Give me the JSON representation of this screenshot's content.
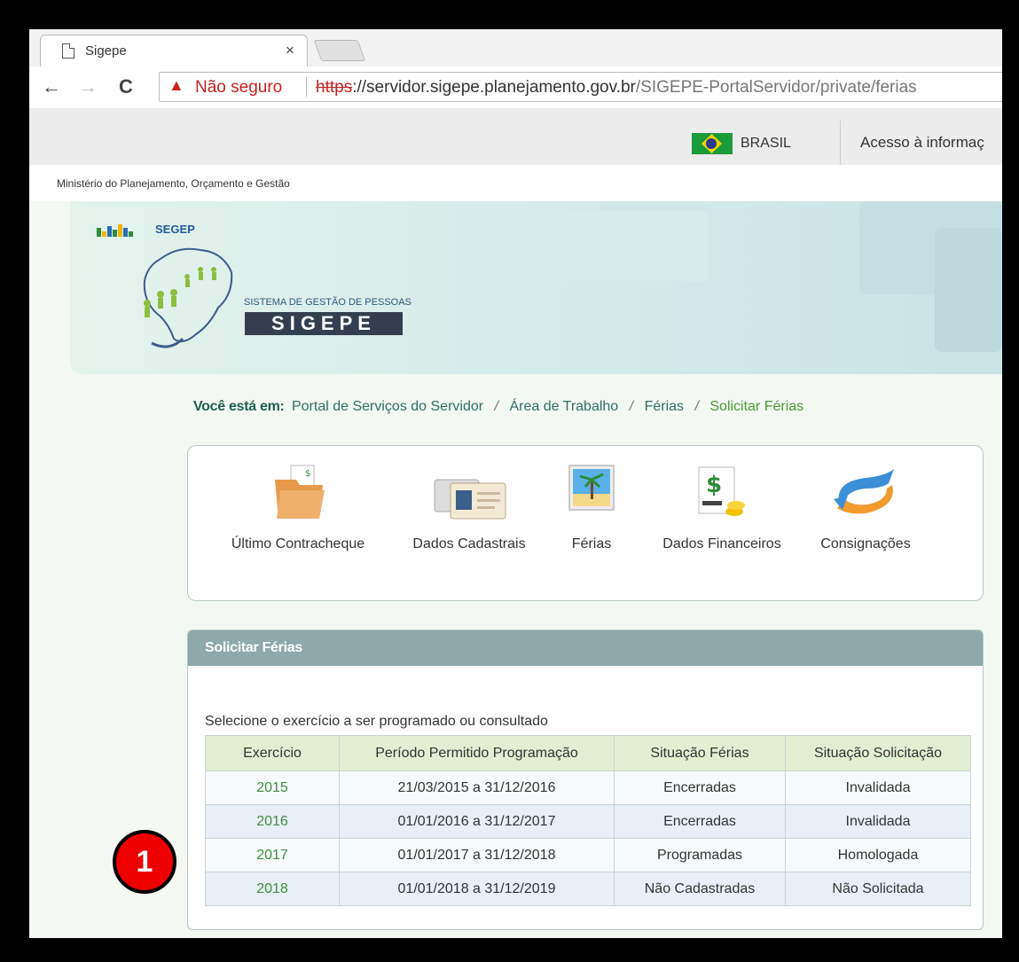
{
  "browser": {
    "tab_title": "Sigepe",
    "tab_close": "×",
    "security_label": "Não seguro",
    "url_scheme": "https",
    "url_sep": "://",
    "url_host": "servidor.sigepe.planejamento.gov.br",
    "url_path": "/SIGEPE-PortalServidor/private/ferias"
  },
  "govbar": {
    "country": "BRASIL",
    "access_info": "Acesso à informaç"
  },
  "ministry": "Ministério do Planejamento, Orçamento e Gestão",
  "brand": {
    "segep": "SEGEP",
    "system_name": "SISTEMA DE GESTÃO DE PESSOAS",
    "logo_text": "SIGEPE"
  },
  "breadcrumb": {
    "label": "Você está em:",
    "items": [
      "Portal de Serviços do Servidor",
      "Área de Trabalho",
      "Férias"
    ],
    "current": "Solicitar Férias",
    "separator": "/"
  },
  "services": [
    {
      "label": "Último Contracheque",
      "icon": "paycheck-folder-icon"
    },
    {
      "label": "Dados Cadastrais",
      "icon": "id-card-icon"
    },
    {
      "label": "Férias",
      "icon": "beach-photo-icon"
    },
    {
      "label": "Dados Financeiros",
      "icon": "money-document-icon"
    },
    {
      "label": "Consignações",
      "icon": "swirl-arrow-icon"
    }
  ],
  "panel": {
    "title": "Solicitar Férias",
    "instruction": "Selecione o exercício a ser programado ou consultado",
    "columns": [
      "Exercício",
      "Período Permitido Programação",
      "Situação Férias",
      "Situação Solicitação"
    ],
    "rows": [
      {
        "exercicio": "2015",
        "periodo": "21/03/2015 a 31/12/2016",
        "situacao_ferias": "Encerradas",
        "situacao_solicitacao": "Invalidada"
      },
      {
        "exercicio": "2016",
        "periodo": "01/01/2016 a 31/12/2017",
        "situacao_ferias": "Encerradas",
        "situacao_solicitacao": "Invalidada"
      },
      {
        "exercicio": "2017",
        "periodo": "01/01/2017 a 31/12/2018",
        "situacao_ferias": "Programadas",
        "situacao_solicitacao": "Homologada"
      },
      {
        "exercicio": "2018",
        "periodo": "01/01/2018 a 31/12/2019",
        "situacao_ferias": "Não Cadastradas",
        "situacao_solicitacao": "Não Solicitada"
      }
    ]
  },
  "callout": "1",
  "colors": {
    "accent_green": "#4c9a35",
    "panel_header": "#8da9aa",
    "callout_red": "#ee0000"
  }
}
